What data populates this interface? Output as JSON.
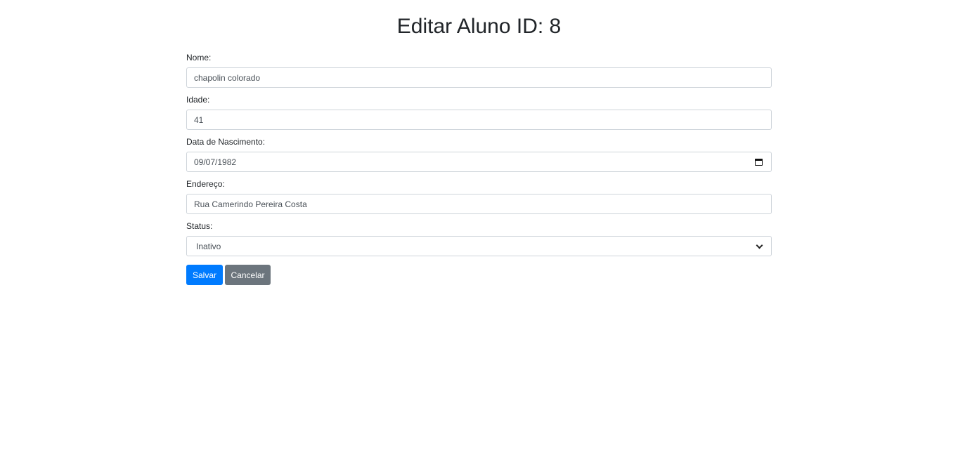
{
  "page": {
    "title": "Editar Aluno ID: 8"
  },
  "form": {
    "nome": {
      "label": "Nome:",
      "value": "chapolin colorado"
    },
    "idade": {
      "label": "Idade:",
      "value": "41"
    },
    "data_nascimento": {
      "label": "Data de Nascimento:",
      "value": "09/07/1982",
      "icon": "calendar-icon"
    },
    "endereco": {
      "label": "Endereço:",
      "value": "Rua Camerindo Pereira Costa"
    },
    "status": {
      "label": "Status:",
      "selected": "Inativo",
      "icon": "chevron-down-icon"
    }
  },
  "actions": {
    "save_label": "Salvar",
    "cancel_label": "Cancelar"
  },
  "colors": {
    "primary": "#007bff",
    "secondary": "#6c757d",
    "border": "#ced4da",
    "text": "#212529"
  }
}
